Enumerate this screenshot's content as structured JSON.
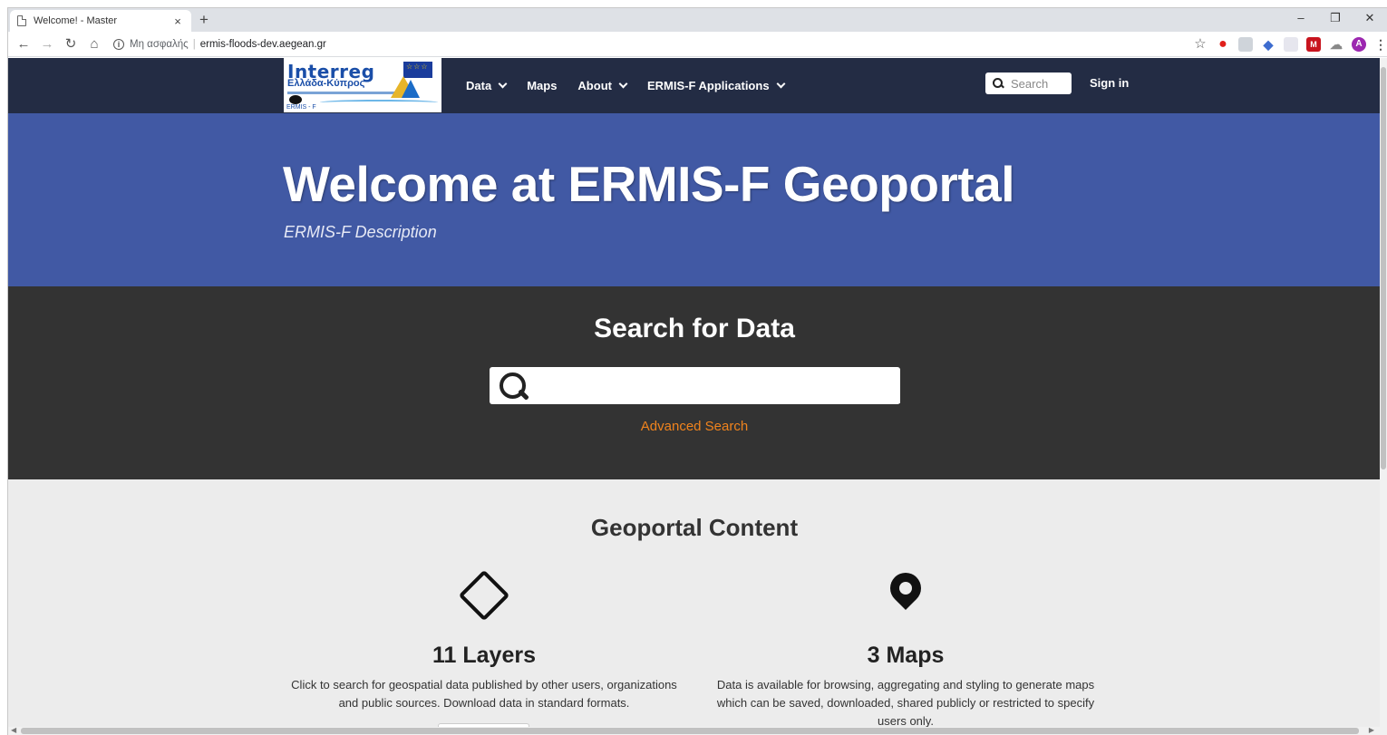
{
  "browser": {
    "tab_title": "Welcome! - Master",
    "tab_close": "×",
    "new_tab": "+",
    "insecure_label": "Μη ασφαλής",
    "url": "ermis-floods-dev.aegean.gr",
    "avatar_letter": "A"
  },
  "nav": {
    "logo_text": "Interreg",
    "logo_country": "Ελλάδα-Κύπρος",
    "logo_tag": "ERMIS - F",
    "items": [
      {
        "label": "Data",
        "has_dropdown": true
      },
      {
        "label": "Maps",
        "has_dropdown": false
      },
      {
        "label": "About",
        "has_dropdown": true
      },
      {
        "label": "ERMIS-F Applications",
        "has_dropdown": true
      }
    ],
    "search_placeholder": "Search",
    "sign_in": "Sign in"
  },
  "hero": {
    "title": "Welcome at ERMIS-F Geoportal",
    "subtitle": "ERMIS-F Description"
  },
  "search": {
    "heading": "Search for Data",
    "input_value": "",
    "advanced_link": "Advanced Search"
  },
  "content": {
    "heading": "Geoportal Content",
    "cards": [
      {
        "icon": "diamond-icon",
        "count": "11 Layers",
        "description": "Click to search for geospatial data published by other users, organizations and public sources. Download data in standard formats."
      },
      {
        "icon": "map-pin-icon",
        "count": "3 Maps",
        "description": "Data is available for browsing, aggregating and styling to generate maps which can be saved, downloaded, shared publicly or restricted to specify users only."
      }
    ]
  },
  "colors": {
    "nav_bg": "#232c44",
    "hero_bg": "#4159a4",
    "search_band_bg": "#333333",
    "content_bg": "#ececec",
    "link_accent": "#f0831d"
  }
}
